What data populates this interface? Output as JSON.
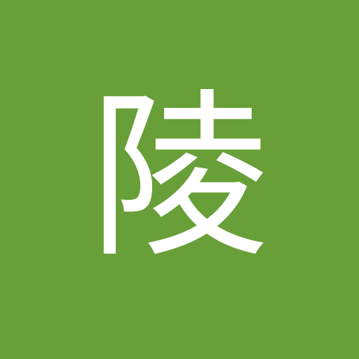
{
  "avatar": {
    "initial": "陵",
    "background_color": "#689f38",
    "text_color": "#ffffff"
  }
}
